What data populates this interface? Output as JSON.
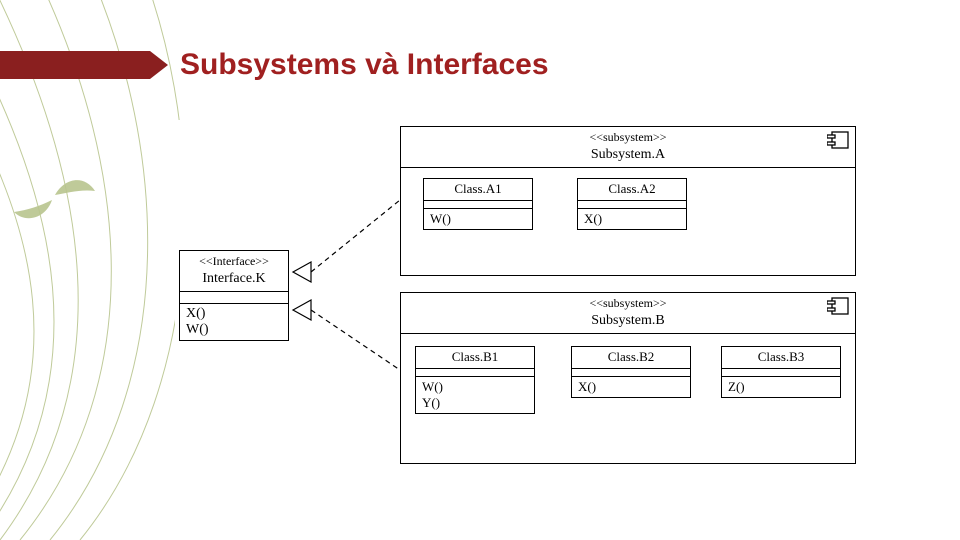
{
  "title": "Subsystems và Interfaces",
  "interface": {
    "stereotype": "<<Interface>>",
    "name": "Interface.K",
    "ops": [
      "X()",
      "W()"
    ]
  },
  "subsystemA": {
    "stereotype": "<<subsystem>>",
    "name": "Subsystem.A",
    "classes": [
      {
        "name": "Class.A1",
        "ops": [
          "W()"
        ]
      },
      {
        "name": "Class.A2",
        "ops": [
          "X()"
        ]
      }
    ]
  },
  "subsystemB": {
    "stereotype": "<<subsystem>>",
    "name": "Subsystem.B",
    "classes": [
      {
        "name": "Class.B1",
        "ops": [
          "W()",
          "Y()"
        ]
      },
      {
        "name": "Class.B2",
        "ops": [
          "X()"
        ]
      },
      {
        "name": "Class.B3",
        "ops": [
          "Z()"
        ]
      }
    ]
  }
}
